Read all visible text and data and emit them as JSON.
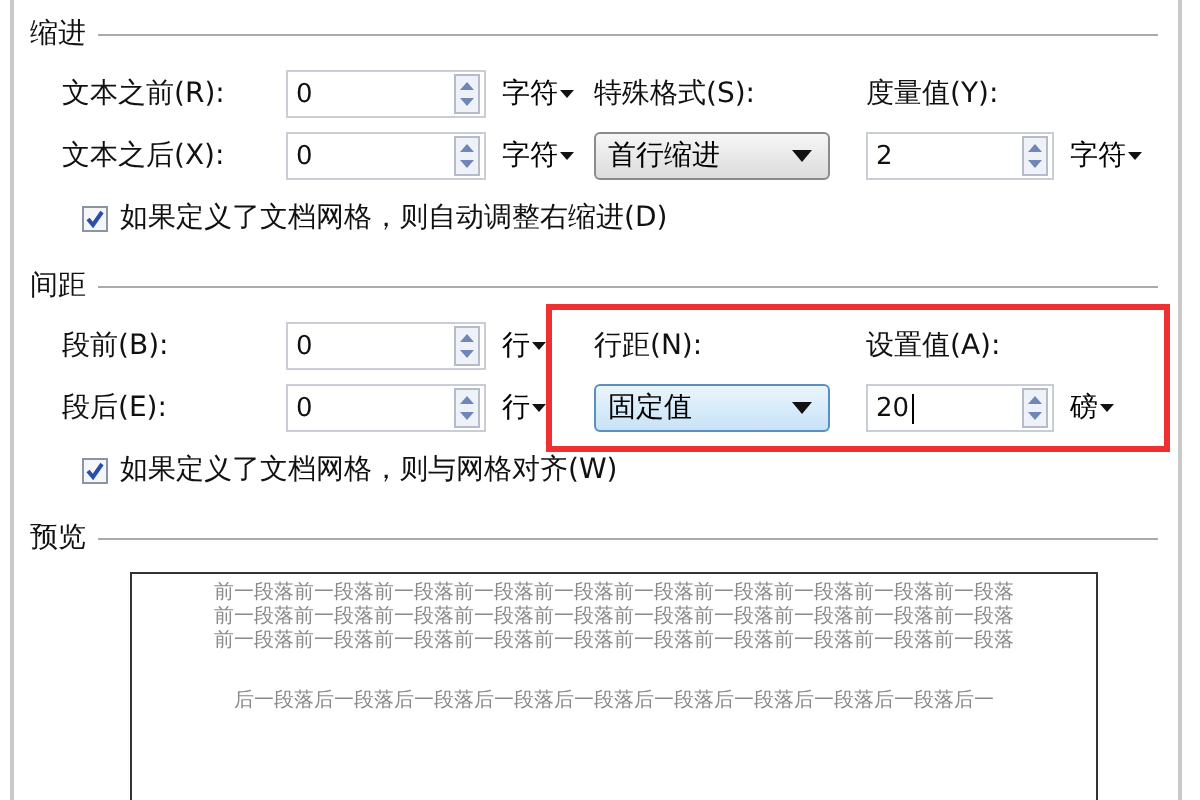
{
  "indent": {
    "title": "缩进",
    "rows": [
      {
        "label": "文本之前(R):",
        "value": "0",
        "unit": "字符"
      },
      {
        "label": "文本之后(X):",
        "value": "0",
        "unit": "字符"
      }
    ],
    "right_a": {
      "label": "特殊格式(S):",
      "value": "首行缩进",
      "focused": false
    },
    "right_b": {
      "label": "度量值(Y):",
      "value": "2",
      "unit": "字符",
      "focused": false
    },
    "checkbox": {
      "label": "如果定义了文档网格，则自动调整右缩进(D)",
      "checked": true
    }
  },
  "spacing": {
    "title": "间距",
    "rows": [
      {
        "label": "段前(B):",
        "value": "0",
        "unit": "行"
      },
      {
        "label": "段后(E):",
        "value": "0",
        "unit": "行"
      }
    ],
    "right_a": {
      "label": "行距(N):",
      "value": "固定值",
      "focused": true
    },
    "right_b": {
      "label": "设置值(A):",
      "value": "20",
      "unit": "磅",
      "focused": true
    },
    "checkbox": {
      "label": "如果定义了文档网格，则与网格对齐(W)",
      "checked": true
    },
    "highlighted": true
  },
  "preview": {
    "title": "预览",
    "lines": [
      "前一段落前一段落前一段落前一段落前一段落前一段落前一段落前一段落前一段落前一段落",
      "前一段落前一段落前一段落前一段落前一段落前一段落前一段落前一段落前一段落前一段落",
      "前一段落前一段落前一段落前一段落前一段落前一段落前一段落前一段落前一段落前一段落",
      "后一段落后一段落后一段落后一段落后一段落后一段落后一段落后一段落后一段落后一"
    ]
  }
}
